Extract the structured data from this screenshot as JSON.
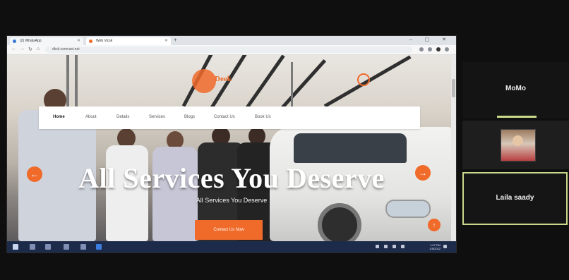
{
  "browser": {
    "tabs": [
      {
        "label": "(2) WhatsApp"
      },
      {
        "label": "Web Vicsk"
      }
    ],
    "new_tab_label": "+",
    "window_controls": "– ▢ ✕",
    "url": "dksk.comcast.net"
  },
  "website": {
    "logo_text": "Deek",
    "menu": [
      "Home",
      "About",
      "Details",
      "Services",
      "Blogs",
      "Contact Us",
      "Book Us"
    ],
    "hero_title": "All Services You Deserve",
    "hero_subtitle": "All Services You Deserve",
    "hero_button_label": "Contact Us Now",
    "prev_arrow": "←",
    "next_arrow": "→",
    "scroll_top_icon": "↑",
    "accent_color": "#f06a2a"
  },
  "taskbar": {
    "time": "1:27 PM",
    "date": "1/5/2022"
  },
  "meeting": {
    "participants": [
      {
        "name": "MoMo"
      },
      {
        "name": "Laila saady"
      }
    ],
    "highlight_color": "#c9d98a"
  }
}
